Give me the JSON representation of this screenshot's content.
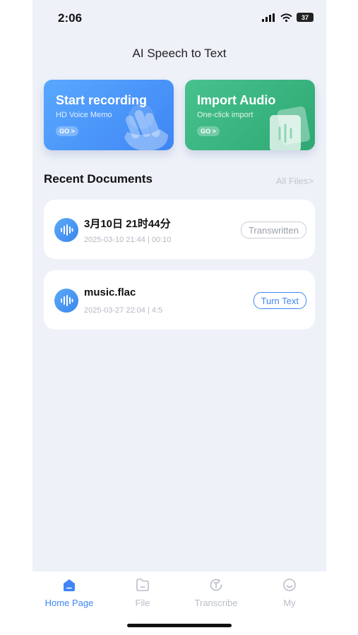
{
  "status_bar": {
    "time": "2:06",
    "battery": "37"
  },
  "header": {
    "title": "AI Speech to Text"
  },
  "cards": {
    "record": {
      "title": "Start recording",
      "subtitle": "HD Voice Memo",
      "go": "GO >"
    },
    "import": {
      "title": "Import Audio",
      "subtitle": "One-click import",
      "go": "GO >"
    }
  },
  "recent": {
    "title": "Recent Documents",
    "all_files": "All Files>",
    "items": [
      {
        "name": "3月10日 21时44分",
        "meta": "2025-03-10 21:44 | 00:10",
        "action": "Transwritten"
      },
      {
        "name": "music.flac",
        "meta": "2025-03-27 22:04 | 4:5",
        "action": "Turn Text"
      }
    ]
  },
  "tabbar": {
    "items": [
      {
        "label": "Home Page"
      },
      {
        "label": "File"
      },
      {
        "label": "Transcribe"
      },
      {
        "label": "My"
      }
    ]
  },
  "colors": {
    "accent": "#3f86f4",
    "import_green": "#2ea873",
    "background": "#eef1f8"
  }
}
